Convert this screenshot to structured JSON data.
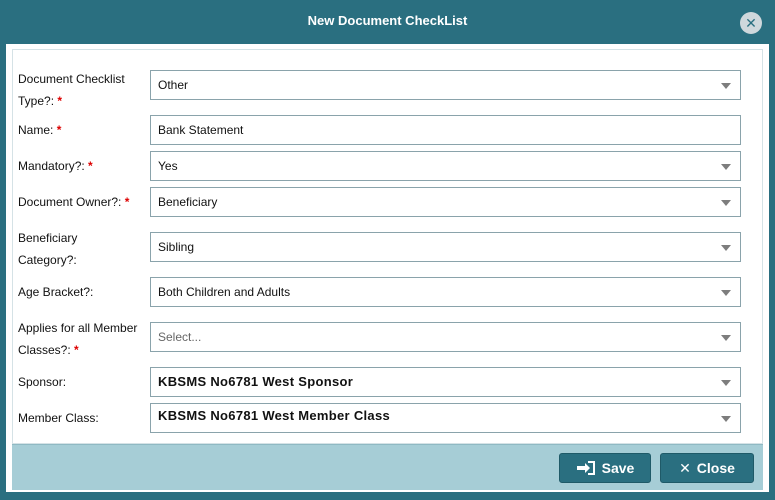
{
  "window": {
    "title": "New Document CheckList",
    "close_glyph": "✕"
  },
  "form": {
    "fields": [
      {
        "label": "Document Checklist Type?:",
        "required": "*",
        "value": "Other",
        "type": "select"
      },
      {
        "label": "Name:",
        "required": "*",
        "value": "Bank Statement",
        "type": "text"
      },
      {
        "label": "Mandatory?:",
        "required": "*",
        "value": "Yes",
        "type": "select"
      },
      {
        "label": "Document Owner?:",
        "required": "*",
        "value": "Beneficiary",
        "type": "select"
      },
      {
        "label": "Beneficiary Category?:",
        "required": "",
        "value": "Sibling",
        "type": "select"
      },
      {
        "label": "Age Bracket?:",
        "required": "",
        "value": "Both Children and Adults",
        "type": "select"
      },
      {
        "label": "Applies for all Member Classes?:",
        "required": "*",
        "value": "Select...",
        "type": "select"
      },
      {
        "label": "Sponsor:",
        "required": "",
        "value": "KBSMS No6781 West Sponsor",
        "type": "select"
      },
      {
        "label": "Member Class:",
        "required": "",
        "value": "KBSMS No6781 West Member Class",
        "type": "select"
      }
    ]
  },
  "footer": {
    "save_label": "Save",
    "close_label": "Close",
    "save_icon": "sign-in-icon",
    "close_icon": "x-icon"
  },
  "colors": {
    "header": "#2a6f80",
    "footer": "#a6cdd6",
    "required": "#dd0000"
  }
}
